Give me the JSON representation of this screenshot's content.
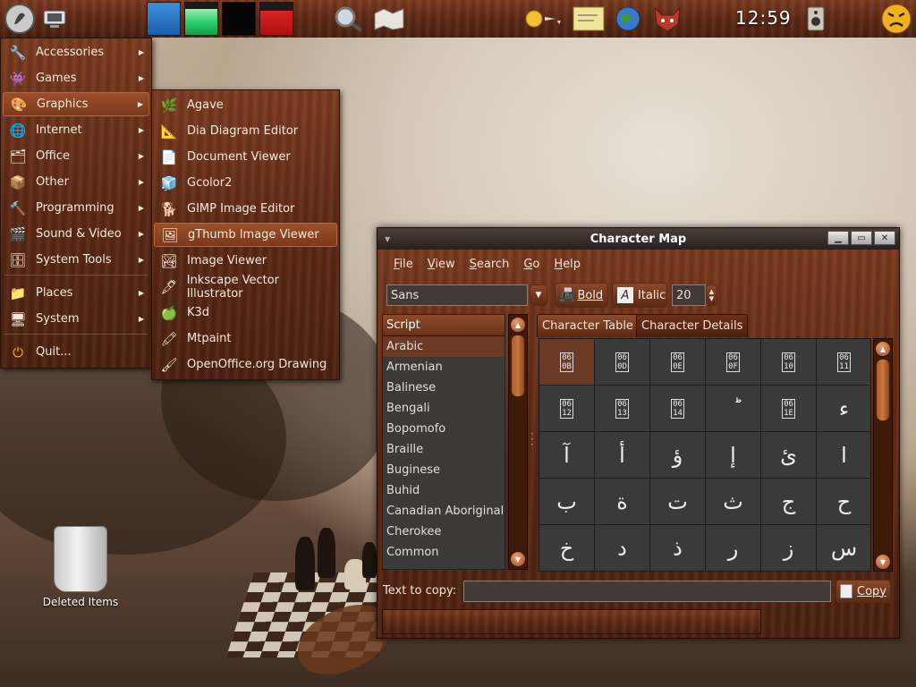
{
  "panel": {
    "clock": "12:59"
  },
  "main_menu": {
    "items": [
      {
        "label": "Accessories",
        "icon": "accessories-icon"
      },
      {
        "label": "Games",
        "icon": "games-icon"
      },
      {
        "label": "Graphics",
        "icon": "graphics-icon"
      },
      {
        "label": "Internet",
        "icon": "internet-icon"
      },
      {
        "label": "Office",
        "icon": "office-icon"
      },
      {
        "label": "Other",
        "icon": "other-icon"
      },
      {
        "label": "Programming",
        "icon": "programming-icon"
      },
      {
        "label": "Sound & Video",
        "icon": "sound-video-icon"
      },
      {
        "label": "System Tools",
        "icon": "system-tools-icon"
      }
    ],
    "places": "Places",
    "system": "System",
    "quit": "Quit..."
  },
  "graphics_menu": {
    "items": [
      {
        "label": "Agave",
        "icon": "agave-icon"
      },
      {
        "label": "Dia Diagram Editor",
        "icon": "dia-icon"
      },
      {
        "label": "Document Viewer",
        "icon": "document-viewer-icon"
      },
      {
        "label": "Gcolor2",
        "icon": "gcolor-icon"
      },
      {
        "label": "GIMP Image Editor",
        "icon": "gimp-icon"
      },
      {
        "label": "gThumb Image Viewer",
        "icon": "gthumb-icon"
      },
      {
        "label": "Image Viewer",
        "icon": "image-viewer-icon"
      },
      {
        "label": "Inkscape Vector Illustrator",
        "icon": "inkscape-icon"
      },
      {
        "label": "K3d",
        "icon": "k3d-icon"
      },
      {
        "label": "Mtpaint",
        "icon": "mtpaint-icon"
      },
      {
        "label": "OpenOffice.org Drawing",
        "icon": "ooo-drawing-icon"
      }
    ]
  },
  "desktop": {
    "trash_label": "Deleted Items"
  },
  "charmap": {
    "title": "Character Map",
    "menus": [
      {
        "pre": "",
        "u": "F",
        "post": "ile"
      },
      {
        "pre": "",
        "u": "V",
        "post": "iew"
      },
      {
        "pre": "",
        "u": "S",
        "post": "earch"
      },
      {
        "pre": "",
        "u": "G",
        "post": "o"
      },
      {
        "pre": "",
        "u": "H",
        "post": "elp"
      }
    ],
    "font": "Sans",
    "bold_label": "Bold",
    "italic_label": "Italic",
    "size": "20",
    "script_header": "Script",
    "scripts": [
      "Arabic",
      "Armenian",
      "Balinese",
      "Bengali",
      "Bopomofo",
      "Braille",
      "Buginese",
      "Buhid",
      "Canadian Aboriginal",
      "Cherokee",
      "Common"
    ],
    "tab_table": "Character Table",
    "tab_details": "Character Details",
    "grid": [
      [
        "060B",
        "060D",
        "060E",
        "060F",
        "0610",
        "0611"
      ],
      [
        "0612",
        "0613",
        "0614",
        "ؕ",
        "061E",
        "ء"
      ],
      [
        "آ",
        "أ",
        "ؤ",
        "إ",
        "ئ",
        "ا"
      ],
      [
        "ب",
        "ة",
        "ت",
        "ث",
        "ج",
        "ح"
      ],
      [
        "خ",
        "د",
        "ذ",
        "ر",
        "ز",
        "س"
      ]
    ],
    "copy_label": "Text to copy:",
    "copy_value": "",
    "copy_button": "Copy"
  }
}
